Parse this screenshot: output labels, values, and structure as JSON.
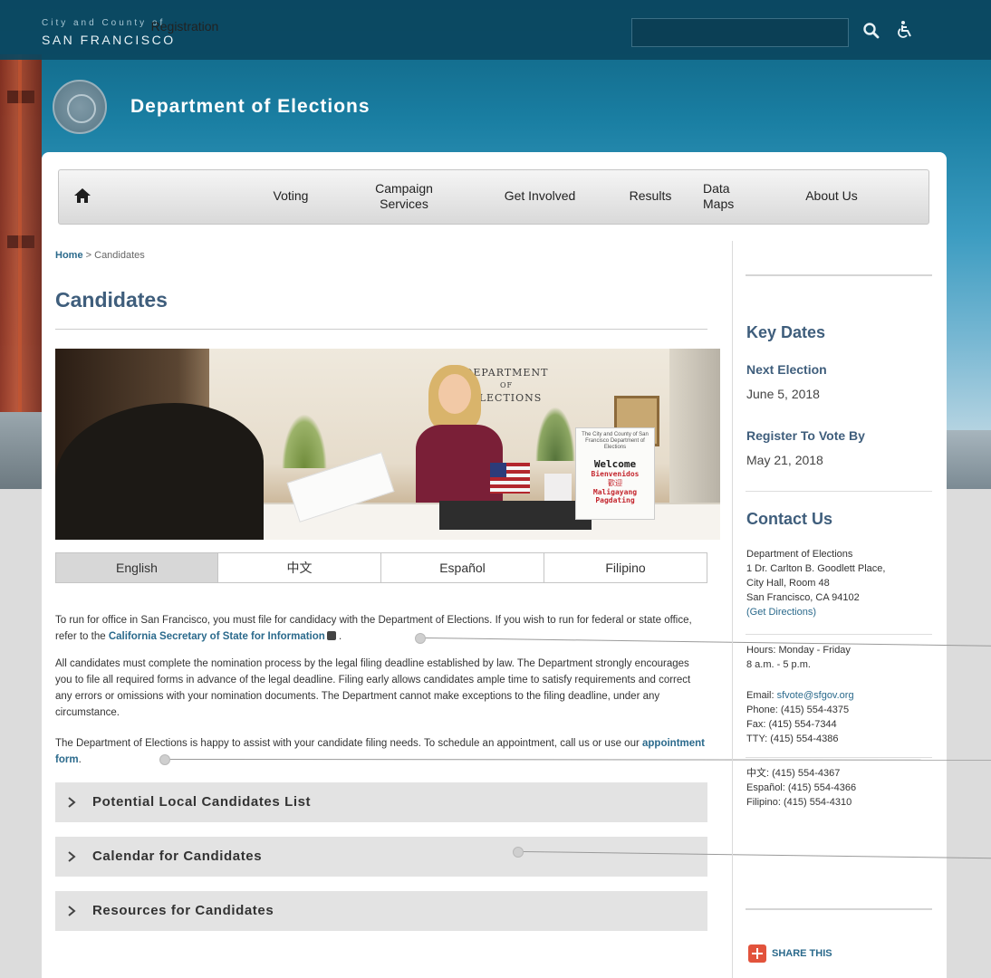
{
  "header": {
    "city_line1": "City and County of",
    "city_line2": "SAN FRANCISCO",
    "department": "Department of Elections",
    "search": {
      "placeholder": "",
      "value": ""
    }
  },
  "nav": {
    "items": [
      {
        "label": "Registration"
      },
      {
        "label": "Voting"
      },
      {
        "label": "Campaign\nServices"
      },
      {
        "label": "Get Involved"
      },
      {
        "label": "Results"
      },
      {
        "label": "Data\nMaps"
      },
      {
        "label": "About Us"
      }
    ]
  },
  "breadcrumb": {
    "home": "Home",
    "separator": ">",
    "current": "Candidates"
  },
  "page_title": "Candidates",
  "photo": {
    "sign_dept": "DEPARTMENT",
    "sign_of": "OF",
    "sign_elections": "ELECTIONS",
    "welcome": "Welcome",
    "bienvenidos": "Bienvenidos",
    "chinese": "歡迎",
    "maligayang": "Maligayang",
    "pagdating": "Pagdating",
    "sign_small": "The City and County of San Francisco Department of Elections"
  },
  "language_tabs": [
    {
      "label": "English",
      "active": true
    },
    {
      "label": "中文",
      "active": false
    },
    {
      "label": "Español",
      "active": false
    },
    {
      "label": "Filipino",
      "active": false
    }
  ],
  "content": {
    "p1_text": "To run for office in San Francisco, you must file for candidacy with the Department of Elections. If you wish to run for federal or state office, refer to the ",
    "p1_link": "California Secretary of State for Information",
    "p1_end": ".",
    "p2": "All candidates must complete the nomination process by the legal filing deadline established by law. The Department strongly encourages you to file all required forms in advance of the legal deadline. Filing early allows candidates ample time to satisfy requirements and correct any errors or omissions with your nomination documents. The Department cannot make exceptions to the filing deadline, under any circumstance.",
    "p3_text": "The Department of Elections is happy to assist with your candidate filing needs. To schedule an appointment, call us or use our ",
    "p3_link": "appointment form",
    "p3_end": "."
  },
  "accordions": [
    {
      "label": "Potential Local Candidates List"
    },
    {
      "label": "Calendar for Candidates"
    },
    {
      "label": "Resources for Candidates"
    }
  ],
  "sidebar": {
    "key_dates_heading": "Key Dates",
    "next_election_label": "Next Election",
    "next_election_date": "June 5, 2018",
    "register_label": "Register To Vote By",
    "register_date": "May 21, 2018",
    "contact_heading": "Contact Us",
    "address": [
      "Department of Elections",
      "1 Dr. Carlton B. Goodlett Place,",
      "City Hall, Room 48",
      "San Francisco, CA 94102"
    ],
    "directions": "(Get Directions)",
    "hours_line1": "Hours: Monday - Friday",
    "hours_line2": "8 a.m. - 5 p.m.",
    "email_label": "Email: ",
    "email": "sfvote@sfgov.org",
    "phone": "Phone: (415) 554-4375",
    "fax": "Fax: (415) 554-7344",
    "tty": "TTY: (415) 554-4386",
    "chinese_phone": "中文: (415) 554-4367",
    "spanish_phone": "Español: (415) 554-4366",
    "filipino_phone": "Filipino: (415) 554-4310",
    "share": "SHARE THIS"
  },
  "colors": {
    "accent_title": "#3f5e7c",
    "link": "#2b6a8c",
    "topbar": "#0b465f",
    "share": "#e2533c"
  },
  "icons": {
    "search": "search-icon",
    "accessibility": "accessibility-icon",
    "home": "home-icon",
    "external": "external-link-icon",
    "chevron": "chevron-right-icon",
    "share": "plus-share-icon"
  }
}
